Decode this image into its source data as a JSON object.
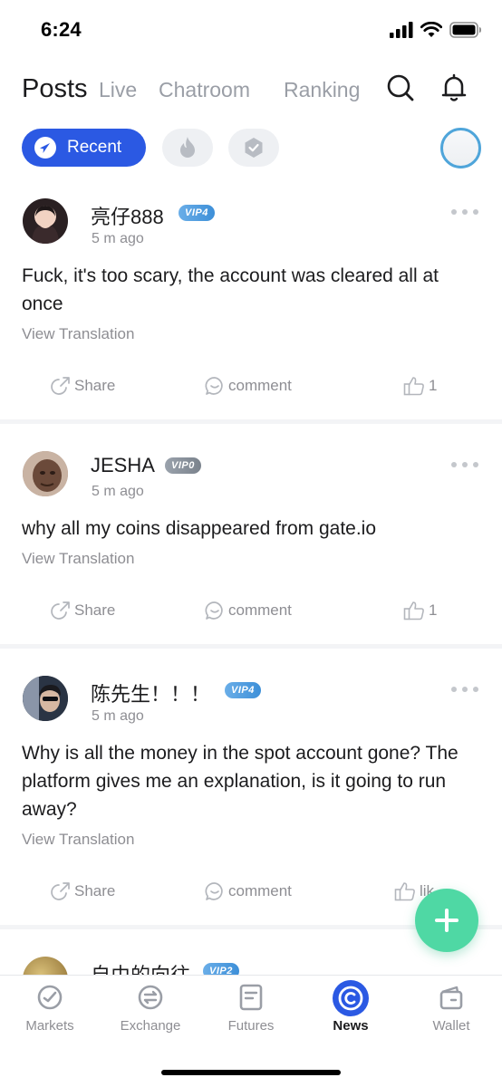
{
  "status_bar": {
    "time": "6:24"
  },
  "nav": {
    "tabs": [
      {
        "label": "Posts",
        "active": true
      },
      {
        "label": "Live"
      },
      {
        "label": "Chatroom"
      },
      {
        "label": "Ranking"
      }
    ],
    "icons": [
      "search-icon",
      "bell-icon"
    ]
  },
  "filters": {
    "recent_label": "Recent",
    "icons": [
      "fire-icon",
      "verified-icon"
    ]
  },
  "posts": [
    {
      "username": "亮仔888",
      "vip": "VIP4",
      "time": "5 m ago",
      "content": "Fuck, it's too scary, the account was cleared all at once",
      "translation": "View Translation",
      "share": "Share",
      "comment": "comment",
      "likes": "1"
    },
    {
      "username": "JESHA",
      "vip": "VIP0",
      "time": "5 m ago",
      "content": "why all my coins disappeared from gate.io",
      "translation": "View Translation",
      "share": "Share",
      "comment": "comment",
      "likes": "1"
    },
    {
      "username": "陈先生！！！",
      "vip": "VIP4",
      "time": "5 m ago",
      "content": "Why is all the money in the spot account gone? The platform gives me an explanation, is it going to run away?",
      "translation": "View Translation",
      "share": "Share",
      "comment": "comment",
      "likes": "lik"
    },
    {
      "username": "自由的向往",
      "vip": "VIP2"
    }
  ],
  "fab": {
    "icon": "plus-icon"
  },
  "tab_bar": {
    "items": [
      {
        "label": "Markets",
        "icon": "markets-icon"
      },
      {
        "label": "Exchange",
        "icon": "exchange-icon"
      },
      {
        "label": "Futures",
        "icon": "futures-icon"
      },
      {
        "label": "News",
        "icon": "news-icon",
        "active": true
      },
      {
        "label": "Wallet",
        "icon": "wallet-icon"
      }
    ]
  },
  "colors": {
    "accent": "#2b59e3",
    "fab": "#4fd8a4",
    "vip_blue": "#3d8fd8",
    "muted": "#8e8e93"
  }
}
